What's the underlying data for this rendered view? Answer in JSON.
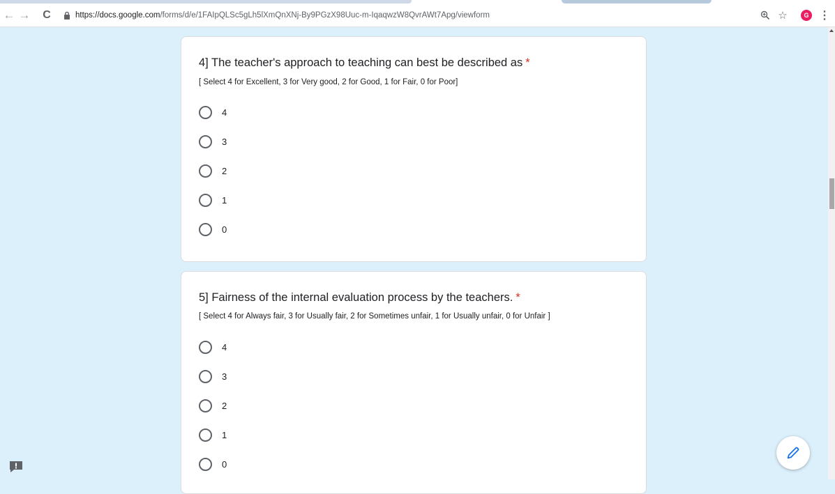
{
  "browser": {
    "back_icon": "←",
    "forward_icon": "→",
    "reload_icon": "C",
    "url_host": "https://docs.google.com",
    "url_path": "/forms/d/e/1FAIpQLSc5gLh5lXmQnXNj-By9PGzX98Uuc-m-IqaqwzW8QvrAWt7Apg/viewform",
    "star_icon": "☆",
    "avatar_letter": "G",
    "menu_icon": "⋮",
    "avatar_color": "#e91e63"
  },
  "questions": [
    {
      "title": "4] The teacher's approach to teaching can best be described as",
      "required_mark": "*",
      "description": "[ Select 4 for Excellent, 3 for Very good, 2 for Good, 1 for Fair, 0 for Poor]",
      "options": [
        "4",
        "3",
        "2",
        "1",
        "0"
      ]
    },
    {
      "title": "5] Fairness of the internal evaluation process by the teachers.",
      "required_mark": "*",
      "description": "[ Select 4 for Always fair, 3 for Usually fair, 2 for Sometimes unfair, 1 for Usually unfair, 0 for Unfair ]",
      "options": [
        "4",
        "3",
        "2",
        "1",
        "0"
      ]
    }
  ],
  "colors": {
    "page_background": "#dcf0fb",
    "required": "#d93025",
    "fab_icon": "#1a73e8"
  },
  "icons": {
    "fab": "pencil-icon",
    "report": "report-problem-icon"
  }
}
